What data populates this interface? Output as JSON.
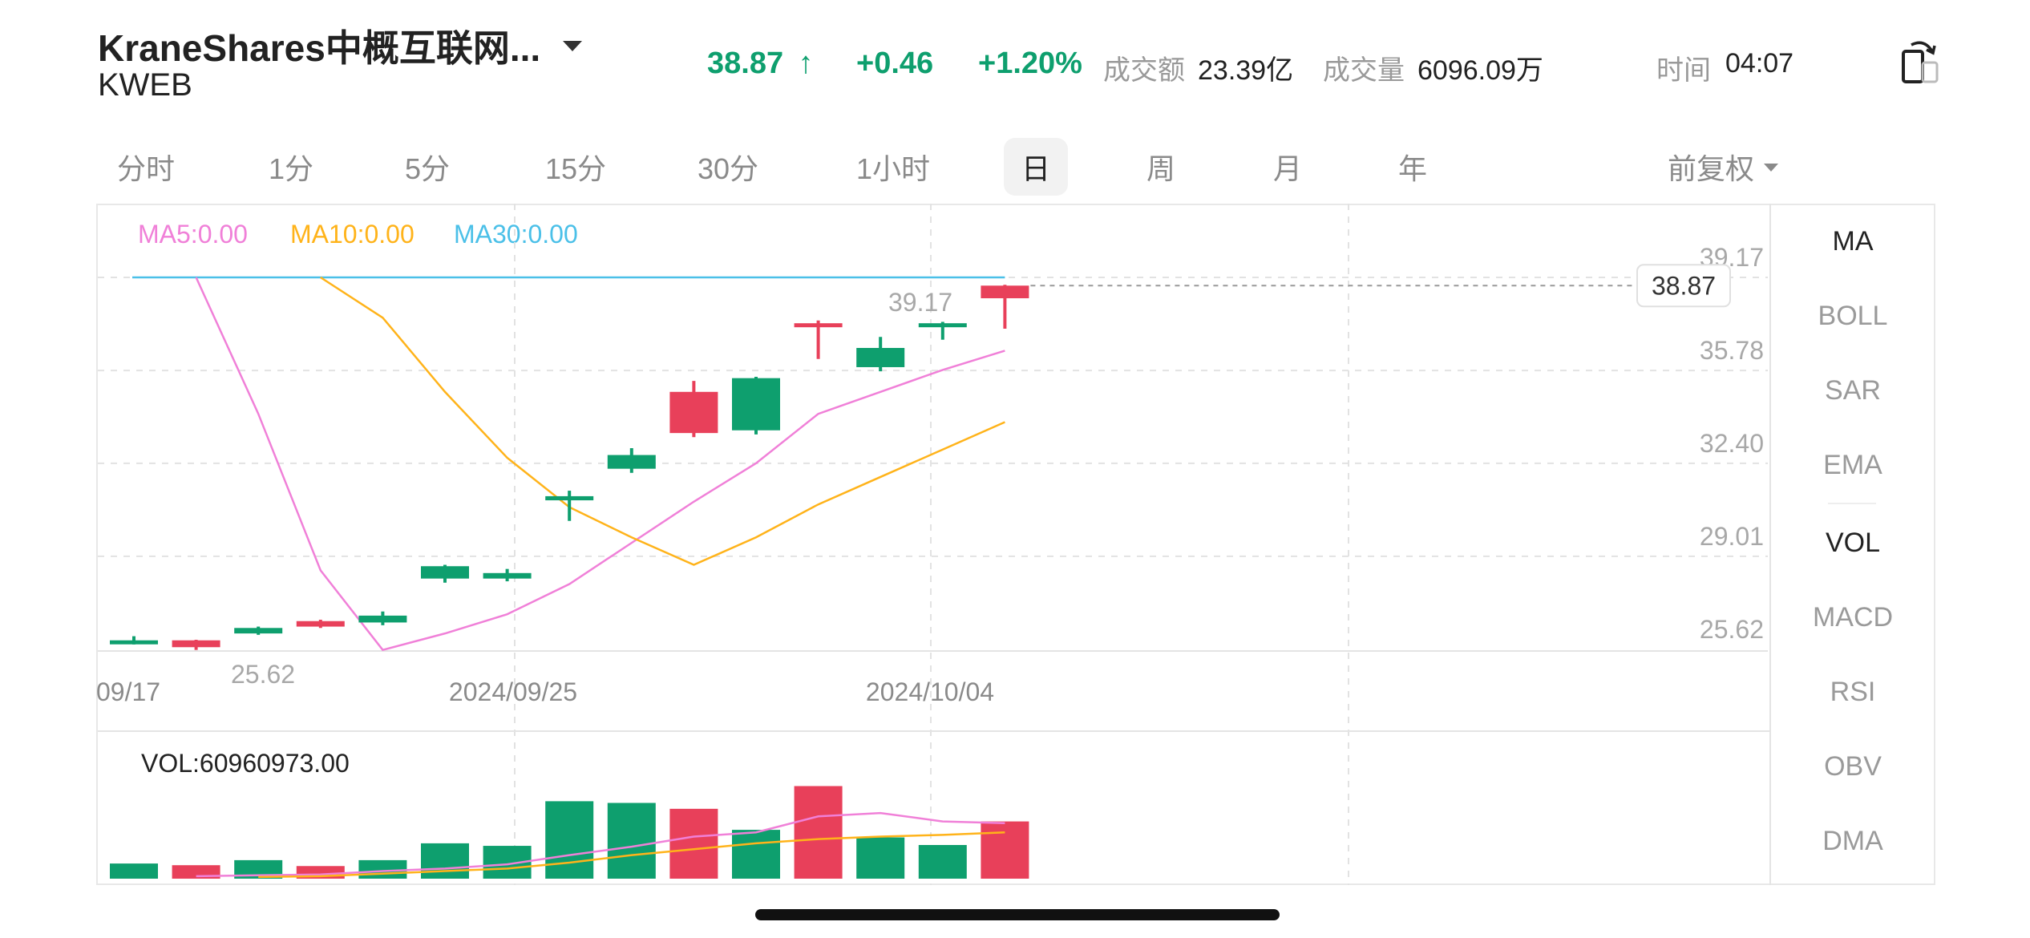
{
  "header": {
    "title": "KraneShares中概互联网...",
    "ticker": "KWEB",
    "price": "38.87",
    "price_arrow": "↑",
    "change": "+0.46",
    "change_pct": "+1.20%",
    "turnover_label": "成交额",
    "turnover_value": "23.39亿",
    "volume_label": "成交量",
    "volume_value": "6096.09万",
    "time_label": "时间",
    "time_value": "04:07"
  },
  "tabs": [
    "分时",
    "1分",
    "5分",
    "15分",
    "30分",
    "1小时",
    "日",
    "周",
    "月",
    "年"
  ],
  "active_tab": "日",
  "adjust_label": "前复权",
  "indicators": [
    "MA",
    "BOLL",
    "SAR",
    "EMA",
    "VOL",
    "MACD",
    "RSI",
    "OBV",
    "DMA"
  ],
  "active_indicators": [
    "MA",
    "VOL"
  ],
  "legend": {
    "ma5": "MA5:0.00",
    "ma10": "MA10:0.00",
    "ma30": "MA30:0.00"
  },
  "vol_label": "VOL:60960973.00",
  "colors": {
    "up": "#0e9f6e",
    "down": "#e8405a",
    "ma5": "#f080d8",
    "ma10": "#ffb31a",
    "ma30": "#4bc0e8"
  },
  "chart_data": {
    "type": "candlestick",
    "y_axis_ticks": [
      "39.17",
      "35.78",
      "32.40",
      "29.01",
      "25.62"
    ],
    "ylim": [
      25.62,
      39.17
    ],
    "x_axis_labels": [
      "09/17",
      "2024/09/25",
      "2024/10/04"
    ],
    "max_label": "39.17",
    "min_label": "25.62",
    "last_price_tag": "38.87",
    "candles": [
      {
        "open": 25.95,
        "close": 25.95,
        "high": 26.1,
        "low": 25.8,
        "dir": "up"
      },
      {
        "open": 25.7,
        "close": 25.95,
        "high": 25.97,
        "low": 25.6,
        "dir": "down"
      },
      {
        "open": 26.4,
        "close": 26.2,
        "high": 26.45,
        "low": 26.15,
        "dir": "up"
      },
      {
        "open": 26.45,
        "close": 26.65,
        "high": 26.7,
        "low": 26.4,
        "dir": "down"
      },
      {
        "open": 26.85,
        "close": 26.6,
        "high": 27.0,
        "low": 26.5,
        "dir": "up"
      },
      {
        "open": 28.65,
        "close": 28.2,
        "high": 28.7,
        "low": 28.05,
        "dir": "up"
      },
      {
        "open": 28.4,
        "close": 28.2,
        "high": 28.55,
        "low": 28.1,
        "dir": "up"
      },
      {
        "open": 31.2,
        "close": 31.05,
        "high": 31.4,
        "low": 30.3,
        "dir": "up"
      },
      {
        "open": 32.7,
        "close": 32.2,
        "high": 32.95,
        "low": 32.05,
        "dir": "up"
      },
      {
        "open": 33.5,
        "close": 35.0,
        "high": 35.4,
        "low": 33.35,
        "dir": "down"
      },
      {
        "open": 35.5,
        "close": 33.6,
        "high": 35.55,
        "low": 33.45,
        "dir": "up"
      },
      {
        "open": 37.5,
        "close": 37.5,
        "high": 37.6,
        "low": 36.2,
        "dir": "down"
      },
      {
        "open": 36.6,
        "close": 35.9,
        "high": 37.0,
        "low": 35.75,
        "dir": "up"
      },
      {
        "open": 37.5,
        "close": 37.4,
        "high": 37.55,
        "low": 36.9,
        "dir": "up"
      },
      {
        "open": 38.41,
        "close": 38.87,
        "high": 38.9,
        "low": 37.3,
        "dir": "down"
      }
    ],
    "ma5": [
      null,
      39.17,
      34.2,
      28.5,
      25.6,
      26.2,
      26.9,
      28.0,
      29.5,
      31.0,
      32.4,
      34.2,
      35.0,
      35.8,
      36.5
    ],
    "ma10": [
      null,
      null,
      null,
      39.17,
      37.7,
      35.0,
      32.6,
      30.8,
      29.7,
      28.7,
      29.7,
      30.9,
      31.9,
      32.9,
      33.9
    ],
    "ma30": [
      39.17,
      39.17,
      39.17,
      39.17,
      39.17,
      39.17,
      39.17,
      39.17,
      39.17,
      39.17,
      39.17,
      39.17,
      39.17,
      39.17,
      39.17
    ],
    "volume": [
      18,
      16,
      22,
      15,
      22,
      42,
      39,
      92,
      90,
      83,
      58,
      110,
      49,
      40,
      68
    ],
    "vol_ma5": [
      null,
      3,
      4,
      5,
      9,
      12,
      17,
      28,
      38,
      50,
      55,
      74,
      78,
      68,
      66
    ],
    "vol_ma10": [
      null,
      null,
      2,
      3,
      6,
      9,
      12,
      19,
      28,
      35,
      42,
      47,
      50,
      52,
      55
    ]
  }
}
